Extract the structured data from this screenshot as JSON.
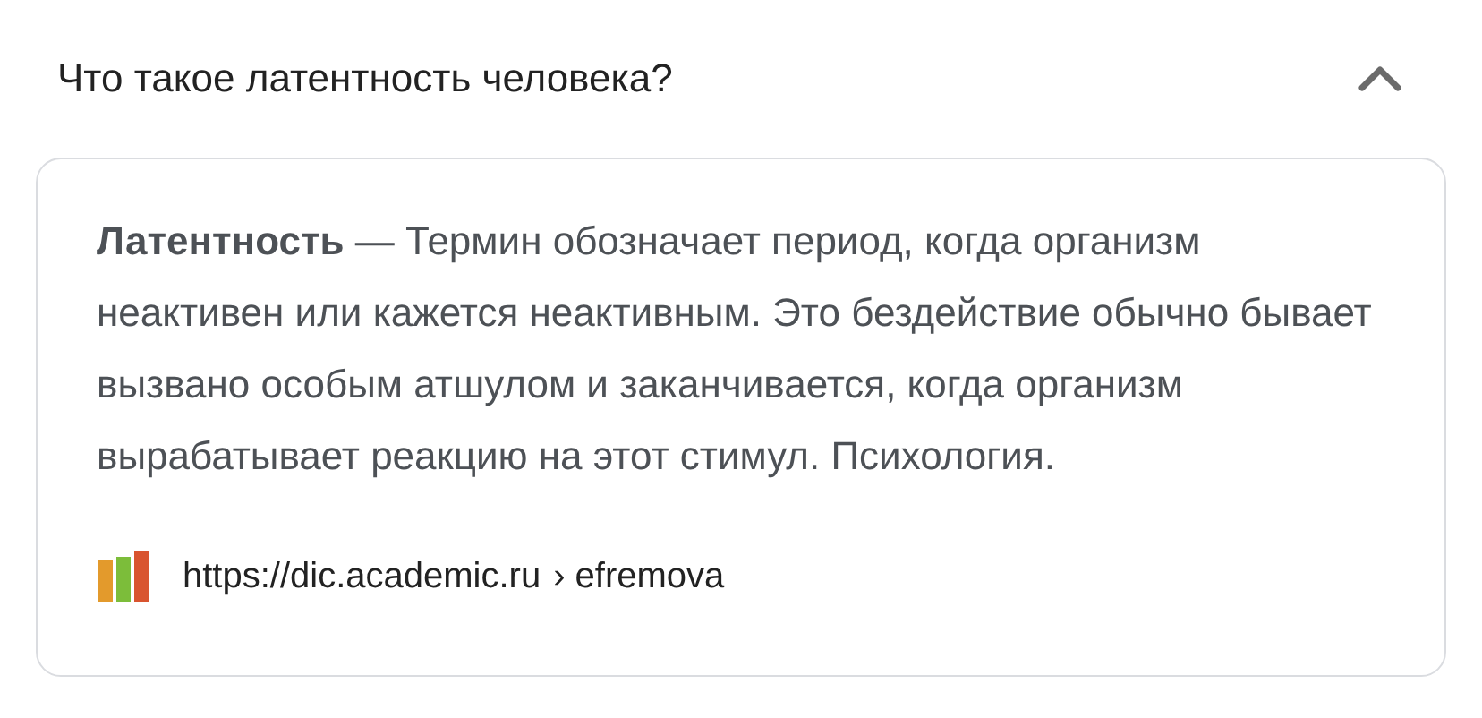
{
  "question": {
    "text": "Что такое латентность человека?",
    "expanded": true
  },
  "answer": {
    "text": "**Латентность** — Термин обозначает период, когда организм неактивен или кажется неактивным. Это бездействие обычно бывает вызвано особым атшулом и заканчивается, когда организм вырабатывает реакцию на этот стимул. Психология.",
    "source": {
      "url": "https://dic.academic.ru",
      "path": "› efremova"
    }
  }
}
